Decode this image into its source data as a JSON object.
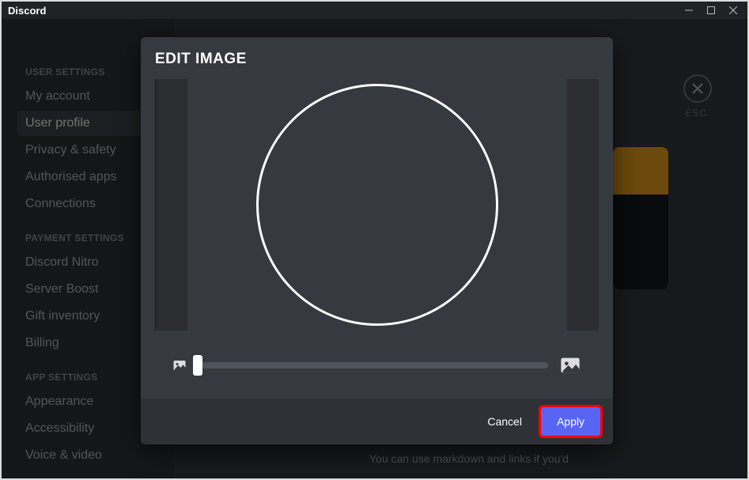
{
  "app": {
    "title": "Discord"
  },
  "window_controls": {
    "min": "minimize",
    "max": "maximize",
    "close": "close"
  },
  "sidebar": {
    "groups": [
      {
        "header": "USER SETTINGS",
        "items": [
          {
            "label": "My account",
            "active": false
          },
          {
            "label": "User profile",
            "active": true
          },
          {
            "label": "Privacy & safety",
            "active": false
          },
          {
            "label": "Authorised apps",
            "active": false
          },
          {
            "label": "Connections",
            "active": false
          }
        ]
      },
      {
        "header": "PAYMENT SETTINGS",
        "items": [
          {
            "label": "Discord Nitro",
            "active": false
          },
          {
            "label": "Server Boost",
            "active": false
          },
          {
            "label": "Gift inventory",
            "active": false
          },
          {
            "label": "Billing",
            "active": false
          }
        ]
      },
      {
        "header": "APP SETTINGS",
        "items": [
          {
            "label": "Appearance",
            "active": false
          },
          {
            "label": "Accessibility",
            "active": false
          },
          {
            "label": "Voice & video",
            "active": false
          }
        ]
      }
    ]
  },
  "close": {
    "esc_label": "ESC"
  },
  "content": {
    "about_hint": "You can use markdown and links if you'd"
  },
  "modal": {
    "title": "EDIT IMAGE",
    "zoom": {
      "value": 0,
      "min": 0,
      "max": 100
    },
    "cancel_label": "Cancel",
    "apply_label": "Apply"
  },
  "colors": {
    "accent": "#5865f2",
    "banner": "#f0a31b",
    "highlight": "#ff0000"
  }
}
